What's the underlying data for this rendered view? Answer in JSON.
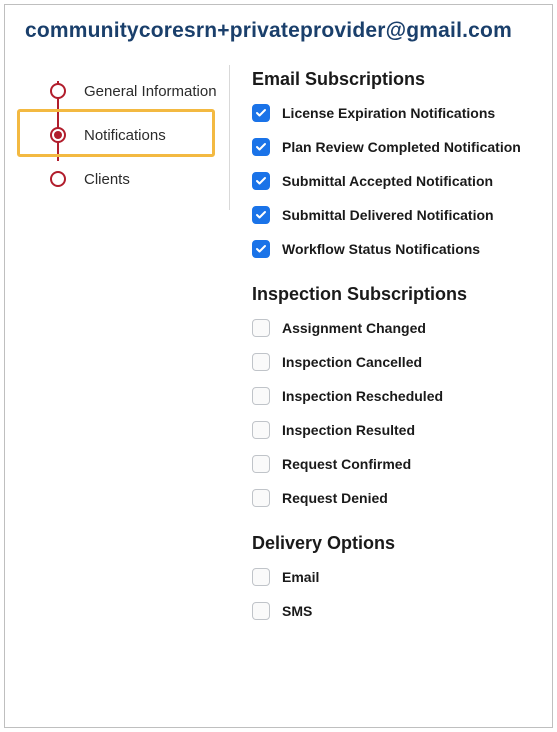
{
  "page_title": "communitycoresrn+privateprovider@gmail.com",
  "colors": {
    "accent": "#b11d2c",
    "highlight": "#f3b941",
    "checkbox_checked": "#1a73e8",
    "title": "#1a3f6b"
  },
  "nav": {
    "items": [
      {
        "label": "General Information",
        "selected": false
      },
      {
        "label": "Notifications",
        "selected": true
      },
      {
        "label": "Clients",
        "selected": false
      }
    ]
  },
  "sections": {
    "email": {
      "title": "Email Subscriptions",
      "options": [
        {
          "label": "License Expiration Notifications",
          "checked": true
        },
        {
          "label": "Plan Review Completed Notification",
          "checked": true
        },
        {
          "label": "Submittal Accepted Notification",
          "checked": true
        },
        {
          "label": "Submittal Delivered Notification",
          "checked": true
        },
        {
          "label": "Workflow Status Notifications",
          "checked": true
        }
      ]
    },
    "inspection": {
      "title": "Inspection Subscriptions",
      "options": [
        {
          "label": "Assignment Changed",
          "checked": false
        },
        {
          "label": "Inspection Cancelled",
          "checked": false
        },
        {
          "label": "Inspection Rescheduled",
          "checked": false
        },
        {
          "label": "Inspection Resulted",
          "checked": false
        },
        {
          "label": "Request Confirmed",
          "checked": false
        },
        {
          "label": "Request Denied",
          "checked": false
        }
      ]
    },
    "delivery": {
      "title": "Delivery Options",
      "options": [
        {
          "label": "Email",
          "checked": false
        },
        {
          "label": "SMS",
          "checked": false
        }
      ]
    }
  }
}
